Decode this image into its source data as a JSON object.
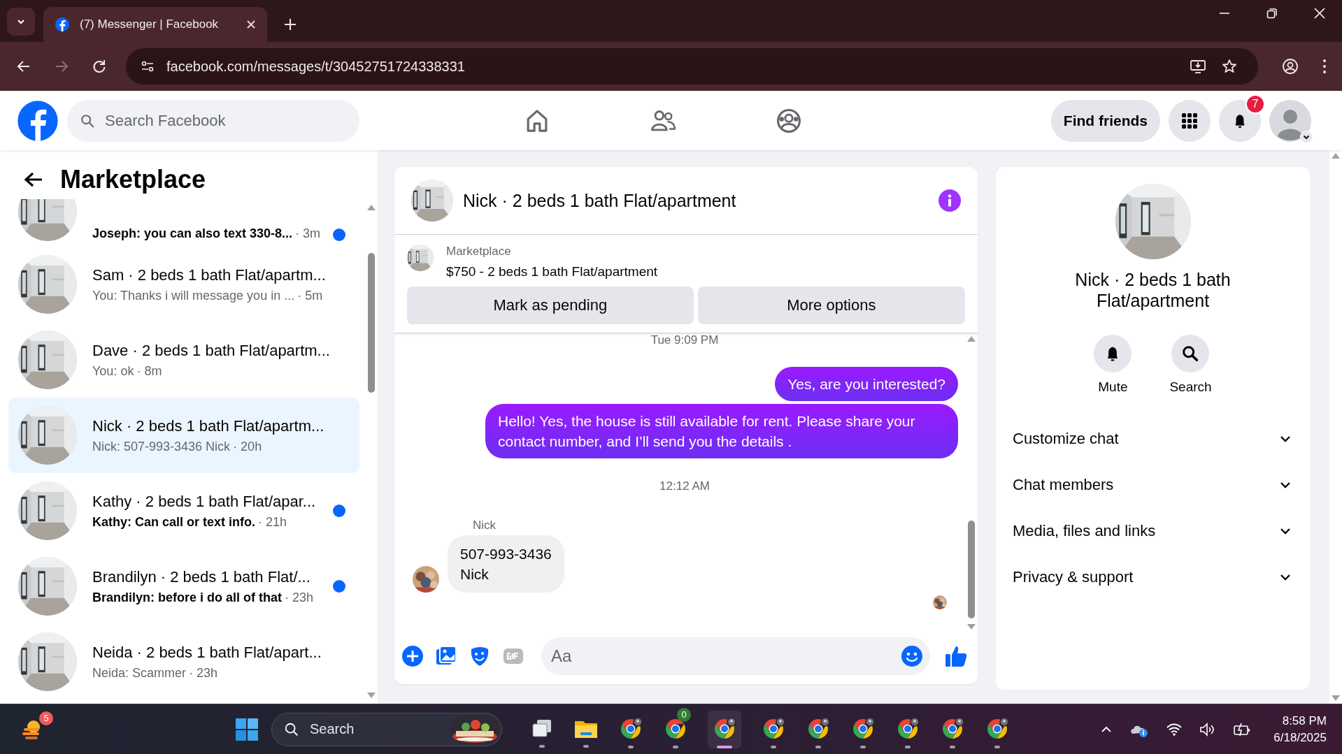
{
  "browser": {
    "tabs": [
      {
        "title": "(7) Messenger | Facebook",
        "selected": true
      }
    ],
    "url": "facebook.com/messages/t/30452751724338331"
  },
  "header": {
    "search_placeholder": "Search Facebook",
    "nav": [
      {
        "kind": "home"
      },
      {
        "kind": "friends"
      },
      {
        "kind": "groups"
      }
    ],
    "find_friends": "Find friends",
    "notification_count": "7"
  },
  "sidebar": {
    "title": "Marketplace",
    "conversations": [
      {
        "preview": "Joseph: you can also text 330-8...",
        "time": "· 3m",
        "unread": true,
        "selected": false
      },
      {
        "title": "Sam · 2 beds 1 bath Flat/apartm...",
        "preview": "You: Thanks i will message you in ...",
        "time": "· 5m",
        "unread": false,
        "selected": false
      },
      {
        "title": "Dave · 2 beds 1 bath Flat/apartm...",
        "preview": "You: ok",
        "time": "· 8m",
        "unread": false,
        "selected": false
      },
      {
        "title": "Nick · 2 beds 1 bath Flat/apartm...",
        "preview": "Nick: 507-993-3436 Nick",
        "time": "· 20h",
        "unread": false,
        "selected": true
      },
      {
        "title": "Kathy · 2 beds 1 bath Flat/apar...",
        "preview": "Kathy: Can call or text info.",
        "time": "· 21h",
        "unread": true,
        "selected": false
      },
      {
        "title": "Brandilyn · 2 beds 1 bath Flat/...",
        "preview": "Brandilyn: before i do all of that",
        "time": "· 23h",
        "unread": true,
        "selected": false
      },
      {
        "title": "Neida · 2 beds 1 bath Flat/apart...",
        "preview": "Neida: Scammer",
        "time": "· 23h",
        "unread": false,
        "selected": false
      }
    ]
  },
  "chat": {
    "title": "Nick · 2 beds 1 bath Flat/apartment",
    "listing": {
      "source": "Marketplace",
      "name": "$750 - 2 beds 1 bath Flat/apartment"
    },
    "actions": [
      "Mark as pending",
      "More options"
    ],
    "messages": [
      {
        "kind": "timestamp",
        "text": "Tue 9:09 PM"
      },
      {
        "kind": "outgoing",
        "text": "Yes, are you interested?"
      },
      {
        "kind": "outgoing",
        "text": "Hello! Yes, the house is still available for rent. Please share your contact number, and I’ll send you the details ."
      },
      {
        "kind": "timestamp",
        "text": "12:12 AM"
      },
      {
        "kind": "incoming",
        "sender": "Nick",
        "text": "507-993-3436\nNick"
      }
    ],
    "composer": {
      "placeholder": "Aa"
    }
  },
  "details": {
    "title": "Nick · 2 beds 1 bath Flat/apartment",
    "actions": [
      {
        "kind": "mute",
        "label": "Mute"
      },
      {
        "kind": "search",
        "label": "Search"
      }
    ],
    "sections": [
      "Customize chat",
      "Chat members",
      "Media, files and links",
      "Privacy & support"
    ]
  },
  "taskbar": {
    "widgets_badge": "5",
    "search_placeholder": "Search",
    "apps": [
      {
        "kind": "task-view",
        "selected": false
      },
      {
        "kind": "explorer",
        "selected": false
      },
      {
        "kind": "chrome",
        "selected": false
      },
      {
        "kind": "chrome",
        "selected": false,
        "badge": "0"
      },
      {
        "kind": "chrome",
        "selected": true
      },
      {
        "kind": "chrome",
        "selected": false
      },
      {
        "kind": "chrome",
        "selected": false
      },
      {
        "kind": "chrome",
        "selected": false
      },
      {
        "kind": "chrome",
        "selected": false
      },
      {
        "kind": "chrome",
        "selected": false
      },
      {
        "kind": "chrome",
        "selected": false
      }
    ],
    "time": "8:58 PM",
    "date": "6/18/2025"
  }
}
